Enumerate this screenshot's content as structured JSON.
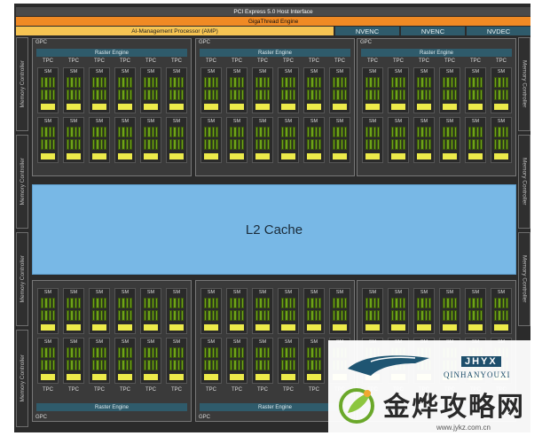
{
  "header": {
    "pci": "PCI Express 5.0 Host Interface",
    "gigathread": "GigaThread Engine",
    "amp": "AI-Management Processor (AMP)",
    "nvenc1": "NVENC",
    "nvenc2": "NVENC",
    "nvdec": "NVDEC"
  },
  "memory_controller_label": "Memory Controller",
  "gpc_label": "GPC",
  "raster_label": "Raster Engine",
  "tpc_label": "TPC",
  "sm_label": "SM",
  "l2_label": "L2 Cache",
  "watermark": {
    "logo_text": "JHYX",
    "small": "QINHANYOUXI",
    "big": "金烨攻略网",
    "url": "www.jykz.com.cn"
  },
  "colors": {
    "cuda_core": "#6ea31a",
    "tensor": "#ecea4a",
    "l2": "#78b8e6",
    "raster": "#2f5b6b"
  }
}
